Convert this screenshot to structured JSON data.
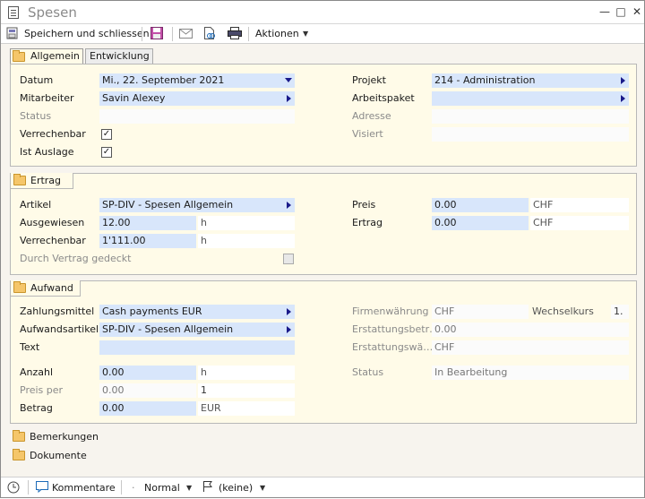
{
  "window": {
    "title": "Spesen"
  },
  "toolbar": {
    "save_close": "Speichern und schliessen",
    "actions": "Aktionen"
  },
  "tabs": {
    "allgemein": "Allgemein",
    "entwicklung": "Entwicklung"
  },
  "allgemein": {
    "datum_label": "Datum",
    "datum_value": "Mi., 22. September 2021",
    "mitarbeiter_label": "Mitarbeiter",
    "mitarbeiter_value": "Savin Alexey",
    "status_label": "Status",
    "verrechenbar_label": "Verrechenbar",
    "ist_auslage_label": "Ist Auslage",
    "projekt_label": "Projekt",
    "projekt_value": "214  -  Administration",
    "arbeitspaket_label": "Arbeitspaket",
    "adresse_label": "Adresse",
    "visiert_label": "Visiert"
  },
  "ertrag": {
    "title": "Ertrag",
    "artikel_label": "Artikel",
    "artikel_value": "SP-DIV  -  Spesen Allgemein",
    "ausgewiesen_label": "Ausgewiesen",
    "ausgewiesen_value": "12.00",
    "ausgewiesen_unit": "h",
    "verrechenbar_label": "Verrechenbar",
    "verrechenbar_value": "1'111.00",
    "verrechenbar_unit": "h",
    "vertrag_label": "Durch Vertrag gedeckt",
    "preis_label": "Preis",
    "preis_value": "0.00",
    "preis_unit": "CHF",
    "ertrag_label": "Ertrag",
    "ertrag_value": "0.00",
    "ertrag_unit": "CHF"
  },
  "aufwand": {
    "title": "Aufwand",
    "zahlungsmittel_label": "Zahlungsmittel",
    "zahlungsmittel_value": "Cash payments EUR",
    "aufwandsartikel_label": "Aufwandsartikel",
    "aufwandsartikel_value": "SP-DIV  -  Spesen Allgemein",
    "text_label": "Text",
    "anzahl_label": "Anzahl",
    "anzahl_value": "0.00",
    "anzahl_unit": "h",
    "preis_per_label": "Preis per",
    "preis_per_value": "0.00",
    "preis_per_unit": "1",
    "betrag_label": "Betrag",
    "betrag_value": "0.00",
    "betrag_unit": "EUR",
    "firmenwaehrung_label": "Firmenwährung",
    "firmenwaehrung_value": "CHF",
    "wechselkurs_label": "Wechselkurs",
    "wechselkurs_value": "1.",
    "erstattungsbetrag_label": "Erstattungsbetr…",
    "erstattungsbetrag_value": "0.00",
    "erstattungswaehrung_label": "Erstattungswä…",
    "erstattungswaehrung_value": "CHF",
    "status_label": "Status",
    "status_value": "In Bearbeitung"
  },
  "sections": {
    "bemerkungen": "Bemerkungen",
    "dokumente": "Dokumente"
  },
  "statusbar": {
    "kommentare": "Kommentare",
    "priority": "Normal",
    "flag": "(keine)"
  }
}
